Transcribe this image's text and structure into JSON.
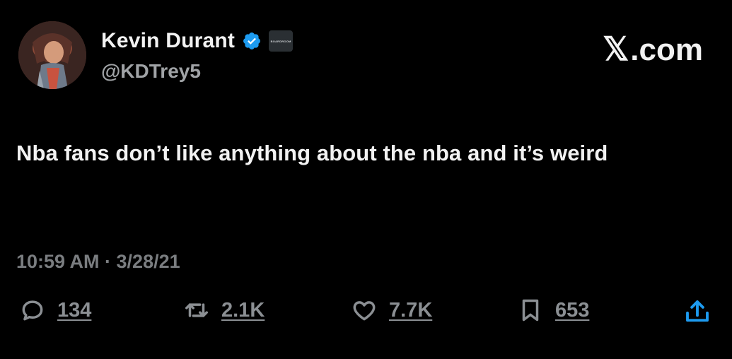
{
  "author": {
    "display_name": "Kevin Durant",
    "handle": "@KDTrey5",
    "affiliate_badge": "BOARDROOM"
  },
  "brand": {
    "x_mark": "𝕏",
    "domain": ".com"
  },
  "tweet": {
    "text": "Nba fans don’t like anything about the nba and it’s weird",
    "meta": "10:59 AM · 3/28/21"
  },
  "actions": {
    "replies": "134",
    "reposts": "2.1K",
    "likes": "7.7K",
    "bookmarks": "653"
  },
  "colors": {
    "background": "#000000",
    "text": "#f2f2f2",
    "muted": "#7a7d80",
    "verified": "#1d9bf0"
  }
}
